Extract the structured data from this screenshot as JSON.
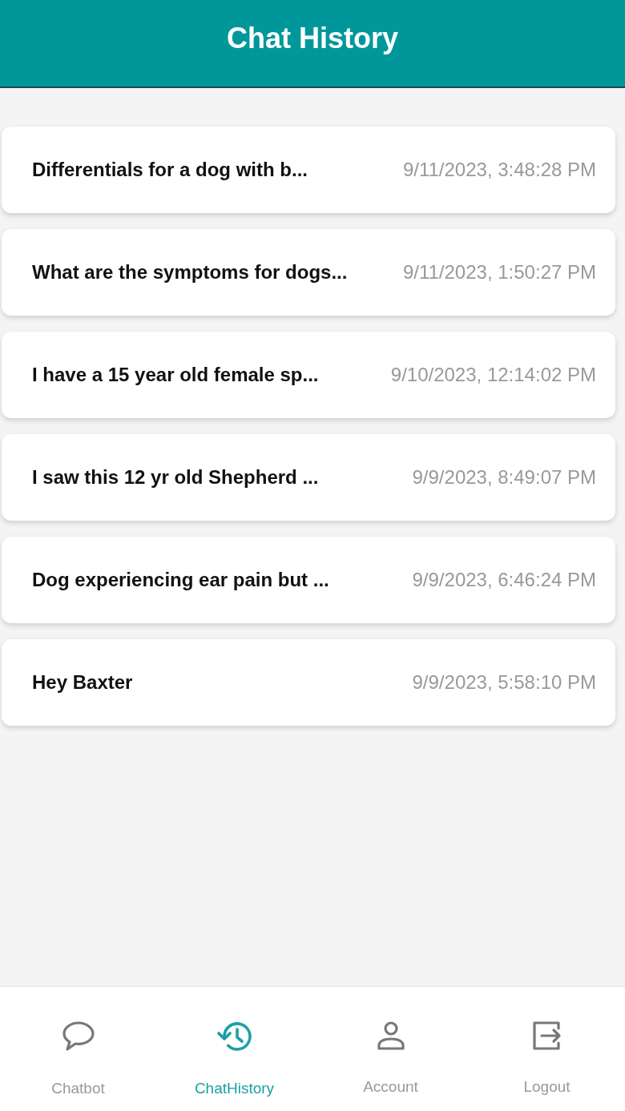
{
  "header": {
    "title": "Chat History"
  },
  "chats": [
    {
      "title": "Differentials for a dog with b...",
      "time": "9/11/2023, 3:48:28 PM"
    },
    {
      "title": "What are the symptoms for dogs...",
      "time": "9/11/2023, 1:50:27 PM"
    },
    {
      "title": "I have a 15 year old female sp...",
      "time": "9/10/2023, 12:14:02 PM"
    },
    {
      "title": "I saw this 12 yr old Shepherd ...",
      "time": "9/9/2023, 8:49:07 PM"
    },
    {
      "title": "Dog experiencing ear pain but ...",
      "time": "9/9/2023, 6:46:24 PM"
    },
    {
      "title": "Hey Baxter",
      "time": "9/9/2023, 5:58:10 PM"
    }
  ],
  "tabs": [
    {
      "label": "Chatbot",
      "selected": false
    },
    {
      "label": "ChatHistory",
      "selected": true
    },
    {
      "label": "Account",
      "selected": false
    },
    {
      "label": "Logout",
      "selected": false
    }
  ]
}
